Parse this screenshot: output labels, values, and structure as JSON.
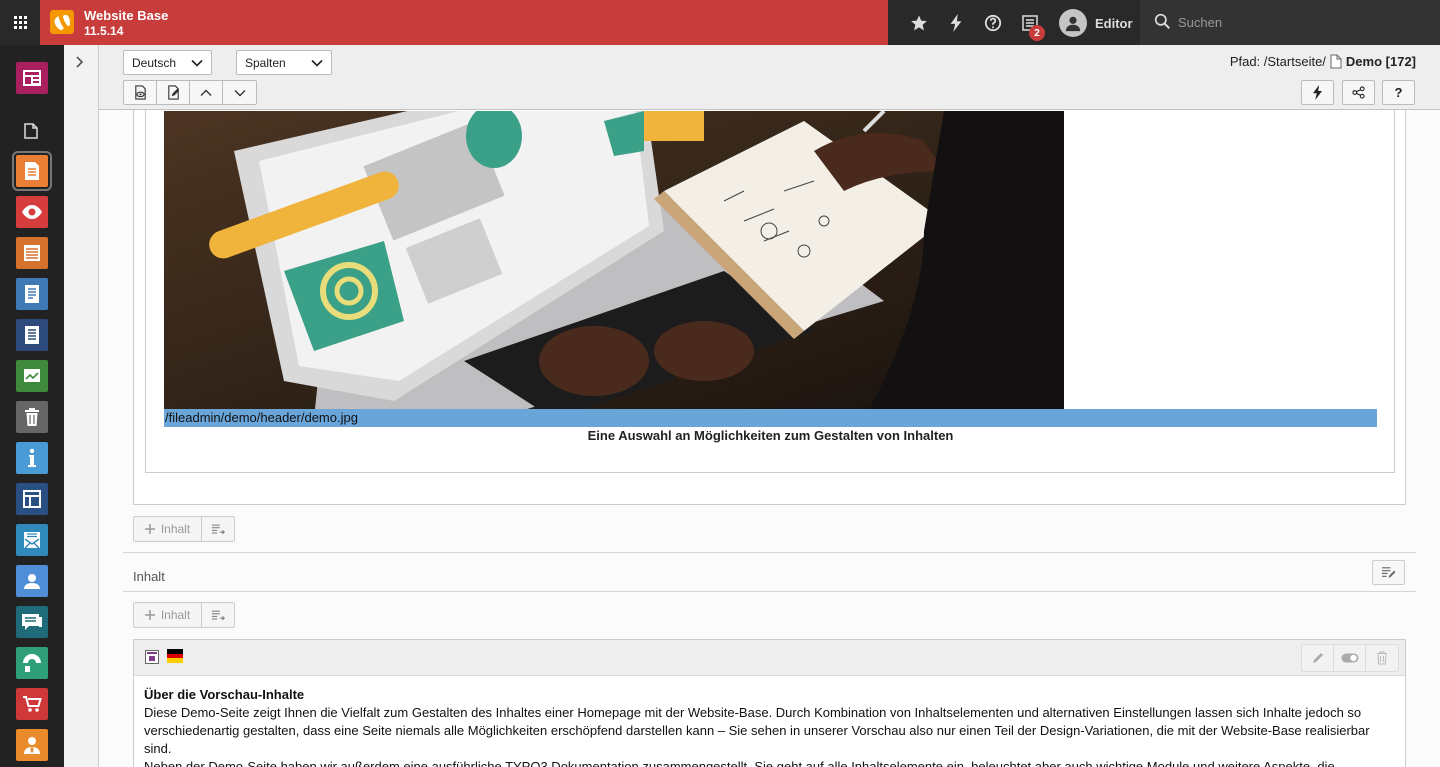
{
  "topbar": {
    "site_name": "Website Base",
    "version": "11.5.14",
    "notification_count": "2",
    "user_name": "Editor",
    "search_placeholder": "Suchen"
  },
  "modules": [
    {
      "name": "module-web-layout",
      "color": "#a8215e"
    },
    {
      "name": "module-page",
      "color": "#e97f34"
    },
    {
      "name": "module-view",
      "color": "#d63c3c"
    },
    {
      "name": "module-list",
      "color": "#d5722e"
    },
    {
      "name": "module-info",
      "color": "#3f7ab7"
    },
    {
      "name": "module-template",
      "color": "#2d4a7c"
    },
    {
      "name": "module-reports",
      "color": "#3f8a3d"
    },
    {
      "name": "module-recycler",
      "color": "#666666"
    },
    {
      "name": "module-help-info",
      "color": "#4a9ad6"
    },
    {
      "name": "module-layout",
      "color": "#2a4f82"
    },
    {
      "name": "module-mail",
      "color": "#2f89bb"
    },
    {
      "name": "module-users",
      "color": "#4f8ed6"
    },
    {
      "name": "module-comments",
      "color": "#1f6b7a"
    },
    {
      "name": "module-extensions",
      "color": "#2f9f7a"
    },
    {
      "name": "module-shop",
      "color": "#cf3838"
    },
    {
      "name": "module-user-settings",
      "color": "#e98a2b"
    }
  ],
  "docheader": {
    "language_select": "Deutsch",
    "view_select": "Spalten",
    "path_label": "Pfad: /Startseite/",
    "page_title": "Demo [172]",
    "help_label": "?"
  },
  "content": {
    "image_path": "/fileadmin/demo/header/demo.jpg",
    "image_caption": "Eine Auswahl an Möglichkeiten zum Gestalten von Inhalten",
    "add_label": "Inhalt",
    "column_title": "Inhalt",
    "element_title": "Über die Vorschau-Inhalte",
    "element_text_1": "Diese Demo-Seite zeigt Ihnen die Vielfalt zum Gestalten des Inhaltes einer Homepage mit der Website-Base. Durch Kombination von Inhaltselementen und alternativen Einstellungen lassen sich Inhalte jedoch so verschiedenartig gestalten, dass eine Seite niemals alle Möglichkeiten erschöpfend darstellen kann – Sie sehen in unserer Vorschau also nur einen Teil der Design-Variationen, die mit der Website-Base realisierbar sind.",
    "element_text_2": "Neben der Demo-Seite haben wir außerdem eine ausführliche TYPO3 Dokumentation zusammengestellt. Sie geht auf alle Inhaltselemente ein, beleuchtet aber auch wichtige Module und weitere Aspekte, die"
  },
  "colors": {
    "brand": "#c83c3c",
    "topbar": "#292929",
    "filepath_highlight": "#6aa5d9"
  }
}
